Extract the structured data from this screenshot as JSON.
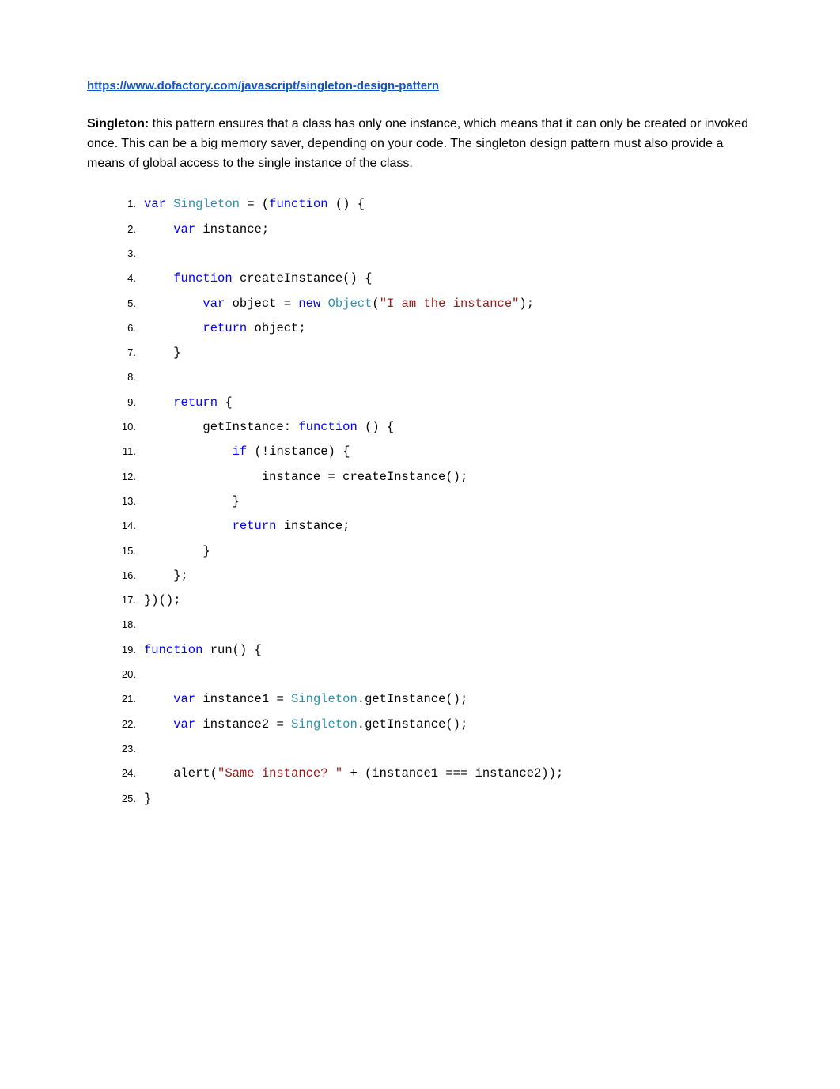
{
  "link": "https://www.dofactory.com/javascript/singleton-design-pattern",
  "paragraph": {
    "bold": "Singleton:",
    "text": " this pattern ensures that a class has only one instance, which means that it can only be created or invoked once. This can be a big memory saver, depending on your code. The singleton design pattern must also provide a means of global access to the single instance of the class."
  },
  "code": [
    {
      "n": "1.",
      "t": [
        {
          "c": "keyword",
          "v": "var"
        },
        {
          "c": "plain",
          "v": " "
        },
        {
          "c": "class",
          "v": "Singleton"
        },
        {
          "c": "plain",
          "v": " = ("
        },
        {
          "c": "keyword",
          "v": "function"
        },
        {
          "c": "plain",
          "v": " () {"
        }
      ]
    },
    {
      "n": "2.",
      "t": [
        {
          "c": "plain",
          "v": "    "
        },
        {
          "c": "keyword",
          "v": "var"
        },
        {
          "c": "plain",
          "v": " instance;"
        }
      ]
    },
    {
      "n": "3.",
      "t": []
    },
    {
      "n": "4.",
      "t": [
        {
          "c": "plain",
          "v": "    "
        },
        {
          "c": "keyword",
          "v": "function"
        },
        {
          "c": "plain",
          "v": " createInstance() {"
        }
      ]
    },
    {
      "n": "5.",
      "t": [
        {
          "c": "plain",
          "v": "        "
        },
        {
          "c": "keyword",
          "v": "var"
        },
        {
          "c": "plain",
          "v": " object = "
        },
        {
          "c": "keyword",
          "v": "new"
        },
        {
          "c": "plain",
          "v": " "
        },
        {
          "c": "class",
          "v": "Object"
        },
        {
          "c": "plain",
          "v": "("
        },
        {
          "c": "string",
          "v": "\"I am the instance\""
        },
        {
          "c": "plain",
          "v": ");"
        }
      ]
    },
    {
      "n": "6.",
      "t": [
        {
          "c": "plain",
          "v": "        "
        },
        {
          "c": "keyword",
          "v": "return"
        },
        {
          "c": "plain",
          "v": " object;"
        }
      ]
    },
    {
      "n": "7.",
      "t": [
        {
          "c": "plain",
          "v": "    }"
        }
      ]
    },
    {
      "n": "8.",
      "t": []
    },
    {
      "n": "9.",
      "t": [
        {
          "c": "plain",
          "v": "    "
        },
        {
          "c": "keyword",
          "v": "return"
        },
        {
          "c": "plain",
          "v": " {"
        }
      ]
    },
    {
      "n": "10.",
      "t": [
        {
          "c": "plain",
          "v": "        getInstance: "
        },
        {
          "c": "keyword",
          "v": "function"
        },
        {
          "c": "plain",
          "v": " () {"
        }
      ]
    },
    {
      "n": "11.",
      "t": [
        {
          "c": "plain",
          "v": "            "
        },
        {
          "c": "keyword",
          "v": "if"
        },
        {
          "c": "plain",
          "v": " (!instance) {"
        }
      ]
    },
    {
      "n": "12.",
      "t": [
        {
          "c": "plain",
          "v": "                instance = createInstance();"
        }
      ]
    },
    {
      "n": "13.",
      "t": [
        {
          "c": "plain",
          "v": "            }"
        }
      ]
    },
    {
      "n": "14.",
      "t": [
        {
          "c": "plain",
          "v": "            "
        },
        {
          "c": "keyword",
          "v": "return"
        },
        {
          "c": "plain",
          "v": " instance;"
        }
      ]
    },
    {
      "n": "15.",
      "t": [
        {
          "c": "plain",
          "v": "        }"
        }
      ]
    },
    {
      "n": "16.",
      "t": [
        {
          "c": "plain",
          "v": "    };"
        }
      ]
    },
    {
      "n": "17.",
      "t": [
        {
          "c": "plain",
          "v": "})();"
        }
      ]
    },
    {
      "n": "18.",
      "t": []
    },
    {
      "n": "19.",
      "t": [
        {
          "c": "keyword",
          "v": "function"
        },
        {
          "c": "plain",
          "v": " run() {"
        }
      ]
    },
    {
      "n": "20.",
      "t": []
    },
    {
      "n": "21.",
      "t": [
        {
          "c": "plain",
          "v": "    "
        },
        {
          "c": "keyword",
          "v": "var"
        },
        {
          "c": "plain",
          "v": " instance1 = "
        },
        {
          "c": "class",
          "v": "Singleton"
        },
        {
          "c": "plain",
          "v": ".getInstance();"
        }
      ]
    },
    {
      "n": "22.",
      "t": [
        {
          "c": "plain",
          "v": "    "
        },
        {
          "c": "keyword",
          "v": "var"
        },
        {
          "c": "plain",
          "v": " instance2 = "
        },
        {
          "c": "class",
          "v": "Singleton"
        },
        {
          "c": "plain",
          "v": ".getInstance();"
        }
      ]
    },
    {
      "n": "23.",
      "t": []
    },
    {
      "n": "24.",
      "t": [
        {
          "c": "plain",
          "v": "    alert("
        },
        {
          "c": "string",
          "v": "\"Same instance? \""
        },
        {
          "c": "plain",
          "v": " + (instance1 === instance2));"
        }
      ]
    },
    {
      "n": "25.",
      "t": [
        {
          "c": "plain",
          "v": "}"
        }
      ]
    }
  ]
}
